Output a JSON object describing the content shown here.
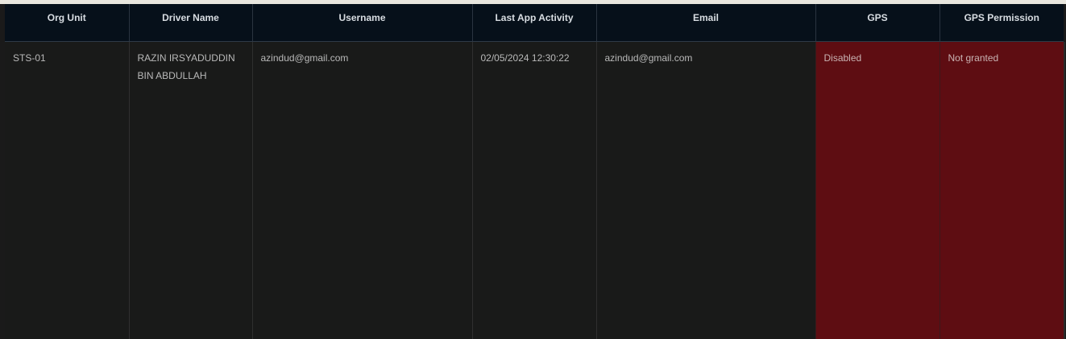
{
  "table": {
    "headers": {
      "org_unit": "Org Unit",
      "driver_name": "Driver Name",
      "username": "Username",
      "last_app_activity": "Last App Activity",
      "email": "Email",
      "gps": "GPS",
      "gps_permission": "GPS Permission"
    },
    "rows": [
      {
        "org_unit": "STS-01",
        "driver_name": "RAZIN IRSYADUDDIN BIN ABDULLAH",
        "username": "azindud@gmail.com",
        "last_app_activity": "02/05/2024 12:30:22",
        "email": "azindud@gmail.com",
        "gps": "Disabled",
        "gps_permission": "Not granted"
      }
    ]
  },
  "colors": {
    "header_bg": "#06101a",
    "cell_bg": "#191a19",
    "alert_bg": "#5e0d12",
    "top_strip": "#e9e7df"
  }
}
